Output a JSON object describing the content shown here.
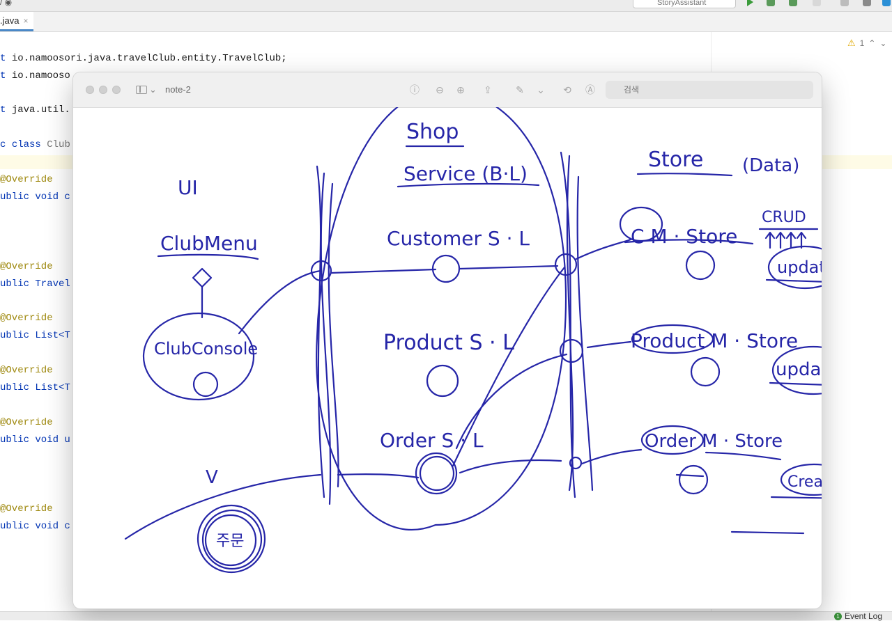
{
  "ide": {
    "file_tab": ".java",
    "tab_close": "×",
    "run_config": "StoryAssistant",
    "warning_count": "1",
    "event_log": "Event Log",
    "code_lines": [
      {
        "pre": "t ",
        "text": "io.namoosori.java.travelClub.entity.TravelClub;"
      },
      {
        "pre": "t ",
        "text": "io.namooso"
      },
      {
        "pre": "t ",
        "text": "java.util."
      },
      {
        "pre": "c ",
        "text": "class ",
        "tail": "Club"
      },
      {
        "pre": "",
        "text": "@Override"
      },
      {
        "pre": "",
        "text": "ublic void c"
      },
      {
        "pre": "",
        "text": "@Override"
      },
      {
        "pre": "",
        "text": "ublic Travel"
      },
      {
        "pre": "",
        "text": "@Override"
      },
      {
        "pre": "",
        "text": "ublic List<T"
      },
      {
        "pre": "",
        "text": "@Override"
      },
      {
        "pre": "",
        "text": "ublic List<T"
      },
      {
        "pre": "",
        "text": "@Override"
      },
      {
        "pre": "",
        "text": "ublic void u"
      },
      {
        "pre": "",
        "text": "@Override"
      },
      {
        "pre": "",
        "text": "ublic void c"
      }
    ]
  },
  "note": {
    "title": "note-2",
    "search_placeholder": "검색"
  },
  "drawing": {
    "ui_label": "UI",
    "club_menu": "ClubMenu",
    "club_console": "ClubConsole",
    "shop": "Shop",
    "service": "Service (B·L)",
    "customer_sl": "Customer S · L",
    "product_sl": "Product S · L",
    "order_sl": "Order S · L",
    "store": "Store",
    "data": "(Data)",
    "crud": "CRUD",
    "c_m_store": "C M · Store",
    "update1": "update",
    "product_m_store": "Product M · Store",
    "update2": "update",
    "order_m_store": "Order M · Store",
    "create": "Create",
    "v_mark": "V",
    "korean_mark": "주문"
  }
}
